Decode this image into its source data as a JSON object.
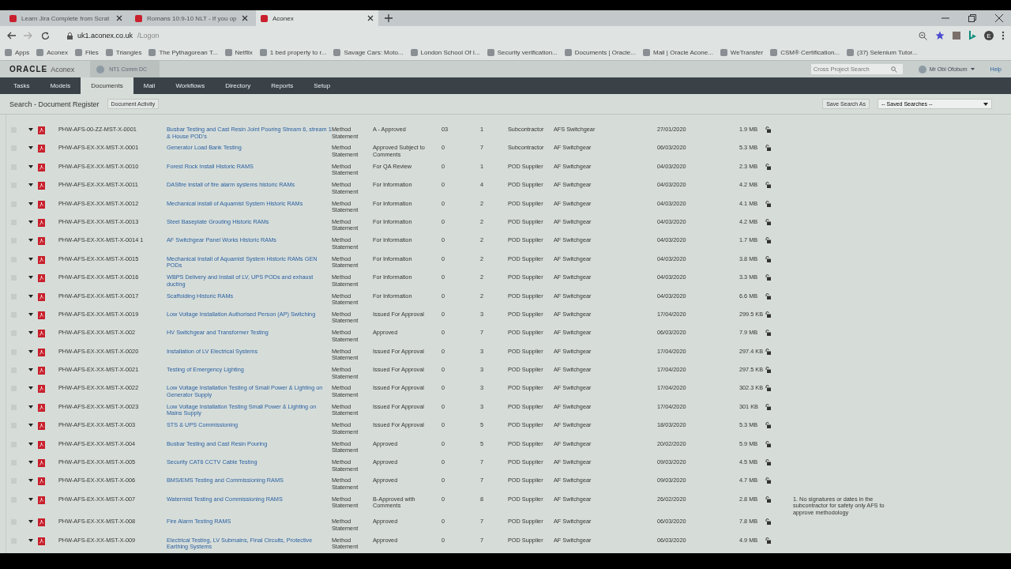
{
  "browser": {
    "tabs": [
      {
        "label": "Learn Jira Complete from Scrat",
        "selected": false
      },
      {
        "label": "Romans 10:9-10 NLT - If you op",
        "selected": false
      },
      {
        "label": "Aconex",
        "selected": true
      }
    ],
    "url_host": "uk1.aconex.co.uk",
    "url_path": "/Logon",
    "bookmarks": [
      "Apps",
      "Aconex",
      "Files",
      "Triangles",
      "The Pythagorean T...",
      "Netflix",
      "1 bed property to r...",
      "Savage Cars: Moto...",
      "London School Of I...",
      "Security verification...",
      "Documents | Oracle...",
      "Mail | Oracle Acone...",
      "WeTransfer",
      "CSM® Certification...",
      "(37) Selenium Tutor..."
    ],
    "profile": "E"
  },
  "app": {
    "brand": "ORACLE",
    "product": "Aconex",
    "project": "NT1 Comm DC",
    "search_placeholder": "Cross Project Search",
    "user": "Mr Obi Ofobum",
    "help": "Help"
  },
  "nav": [
    {
      "label": "Tasks",
      "selected": false
    },
    {
      "label": "Models",
      "selected": false
    },
    {
      "label": "Documents",
      "selected": true
    },
    {
      "label": "Mail",
      "selected": false
    },
    {
      "label": "Workflows",
      "selected": false
    },
    {
      "label": "Directory",
      "selected": false
    },
    {
      "label": "Reports",
      "selected": false
    },
    {
      "label": "Setup",
      "selected": false
    }
  ],
  "toolbar": {
    "title": "Search - Document Register",
    "activity": "Document Activity",
    "save_search": "Save Search As",
    "saved_searches": "-- Saved Searches --"
  },
  "rows": [
    {
      "checked": false,
      "number": "PHW-AFS-00-ZZ-MST-X-0001",
      "title": "Busbar Testing and Cast Resin Joint Pouring Stream 6, stream 1 & House POD's",
      "type": "Method Statement",
      "status": "A - Approved",
      "rev": "03",
      "version": "1",
      "discipline": "Subcontractor",
      "company": "AFS Switchgear",
      "date": "27/01/2020",
      "size": "1.9 MB"
    },
    {
      "checked": false,
      "number": "PHW-AFS-EX-XX-MST-X-0001",
      "title": "Generator Load Bank Testing",
      "type": "Method Statement",
      "status": "Approved Subject to Comments",
      "rev": "0",
      "version": "7",
      "discipline": "Subcontractor",
      "company": "AF Switchgear",
      "date": "06/03/2020",
      "size": "5.3 MB"
    },
    {
      "checked": false,
      "number": "PHW-AFS-EX-XX-MST-X-0010",
      "title": "Forest Rock Install Historic RAMS",
      "type": "Method Statement",
      "status": "For QA Review",
      "rev": "0",
      "version": "1",
      "discipline": "POD Supplier",
      "company": "AF Switchgear",
      "date": "04/03/2020",
      "size": "2.3 MB"
    },
    {
      "checked": false,
      "number": "PHW-AFS-EX-XX-MST-X-0011",
      "title": "DASfire install of fire alarm systems historic RAMs",
      "type": "Method Statement",
      "status": "For Information",
      "rev": "0",
      "version": "4",
      "discipline": "POD Supplier",
      "company": "AF Switchgear",
      "date": "04/03/2020",
      "size": "4.2 MB"
    },
    {
      "checked": false,
      "number": "PHW-AFS-EX-XX-MST-X-0012",
      "title": "Mechanical install of Aquamist System Historic RAMs",
      "type": "Method Statement",
      "status": "For Information",
      "rev": "0",
      "version": "2",
      "discipline": "POD Supplier",
      "company": "AF Switchgear",
      "date": "04/03/2020",
      "size": "4.1 MB"
    },
    {
      "checked": false,
      "number": "PHW-AFS-EX-XX-MST-X-0013",
      "title": "Steel Baseplate Grouting Historic RAMs",
      "type": "Method Statement",
      "status": "For Information",
      "rev": "0",
      "version": "2",
      "discipline": "POD Supplier",
      "company": "AF Switchgear",
      "date": "04/03/2020",
      "size": "4.2 MB"
    },
    {
      "checked": false,
      "number": "PHW-AFS-EX-XX-MST-X-0014 1",
      "title": "AF Switchgear Panel Works Historic RAMs",
      "type": "Method Statement",
      "status": "For Information",
      "rev": "0",
      "version": "2",
      "discipline": "POD Supplier",
      "company": "AF Switchgear",
      "date": "04/03/2020",
      "size": "1.7 MB"
    },
    {
      "checked": false,
      "number": "PHW-AFS-EX-XX-MST-X-0015",
      "title": "Mechanical Install of Aquamist System Historic RAMs GEN PODs",
      "type": "Method Statement",
      "status": "For Information",
      "rev": "0",
      "version": "2",
      "discipline": "POD Supplier",
      "company": "AF Switchgear",
      "date": "04/03/2020",
      "size": "3.8 MB"
    },
    {
      "checked": false,
      "number": "PHW-AFS-EX-XX-MST-X-0016",
      "title": "WBPS Delivery and Install of LV, UPS PODs and exhaust ducting",
      "type": "Method Statement",
      "status": "For Information",
      "rev": "0",
      "version": "2",
      "discipline": "POD Supplier",
      "company": "AF Switchgear",
      "date": "04/03/2020",
      "size": "3.3 MB"
    },
    {
      "checked": false,
      "number": "PHW-AFS-EX-XX-MST-X-0017",
      "title": "Scaffolding Historic RAMs",
      "type": "Method Statement",
      "status": "For Information",
      "rev": "0",
      "version": "2",
      "discipline": "POD Supplier",
      "company": "AF Switchgear",
      "date": "04/03/2020",
      "size": "6.6 MB"
    },
    {
      "checked": false,
      "number": "PHW-AFS-EX-XX-MST-X-0019",
      "title": "Low Voltage Installation Authorised Person (AP) Switching",
      "type": "Method Statement",
      "status": "Issued For Approval",
      "rev": "0",
      "version": "3",
      "discipline": "POD Supplier",
      "company": "AF Switchgear",
      "date": "17/04/2020",
      "size": "299.5 KB"
    },
    {
      "checked": false,
      "number": "PHW-AFS-EX-XX-MST-X-002",
      "title": "HV Switchgear and Transformer Testing",
      "type": "Method Statement",
      "status": "Approved",
      "rev": "0",
      "version": "7",
      "discipline": "POD Supplier",
      "company": "AF Switchgear",
      "date": "06/03/2020",
      "size": "7.9 MB"
    },
    {
      "checked": false,
      "number": "PHW-AFS-EX-XX-MST-X-0020",
      "title": "Installation of LV Electrical Systems",
      "type": "Method Statement",
      "status": "Issued For Approval",
      "rev": "0",
      "version": "3",
      "discipline": "POD Supplier",
      "company": "AF Switchgear",
      "date": "17/04/2020",
      "size": "297.4 KB"
    },
    {
      "checked": false,
      "number": "PHW-AFS-EX-XX-MST-X-0021",
      "title": "Testing of Emergency Lighting",
      "type": "Method Statement",
      "status": "Issued For Approval",
      "rev": "0",
      "version": "3",
      "discipline": "POD Supplier",
      "company": "AF Switchgear",
      "date": "17/04/2020",
      "size": "297.5 KB"
    },
    {
      "checked": false,
      "number": "PHW-AFS-EX-XX-MST-X-0022",
      "title": "Low Voltage Installation Testing of Small Power & Lighting on Generator Supply",
      "type": "Method Statement",
      "status": "Issued For Approval",
      "rev": "0",
      "version": "3",
      "discipline": "POD Supplier",
      "company": "AF Switchgear",
      "date": "17/04/2020",
      "size": "302.3 KB"
    },
    {
      "checked": false,
      "number": "PHW-AFS-EX-XX-MST-X-0023",
      "title": "Low Voltage Installation Testing Small Power & Lighting on Mains Supply",
      "type": "Method Statement",
      "status": "Issued For Approval",
      "rev": "0",
      "version": "3",
      "discipline": "POD Supplier",
      "company": "AF Switchgear",
      "date": "17/04/2020",
      "size": "301 KB"
    },
    {
      "checked": false,
      "number": "PHW-AFS-EX-XX-MST-X-003",
      "title": "STS & UPS Commissioning",
      "type": "Method Statement",
      "status": "Issued For Approval",
      "rev": "0",
      "version": "5",
      "discipline": "POD Supplier",
      "company": "AF Switchgear",
      "date": "18/03/2020",
      "size": "5.3 MB"
    },
    {
      "checked": false,
      "number": "PHW-AFS-EX-XX-MST-X-004",
      "title": "Busbar Testing and Cast Resin Pouring",
      "type": "Method Statement",
      "status": "Approved",
      "rev": "0",
      "version": "5",
      "discipline": "POD Supplier",
      "company": "AF Switchgear",
      "date": "20/02/2020",
      "size": "5.9 MB"
    },
    {
      "checked": false,
      "number": "PHW-AFS-EX-XX-MST-X-005",
      "title": "Security CAT6 CCTV Cable Testing",
      "type": "Method Statement",
      "status": "Approved",
      "rev": "0",
      "version": "7",
      "discipline": "POD Supplier",
      "company": "AF Switchgear",
      "date": "09/03/2020",
      "size": "4.5 MB"
    },
    {
      "checked": false,
      "number": "PHW-AFS-EX-XX-MST-X-006",
      "title": "BMS/EMS Testing and Commissioning RAMS",
      "type": "Method Statement",
      "status": "Approved",
      "rev": "0",
      "version": "7",
      "discipline": "POD Supplier",
      "company": "AF Switchgear",
      "date": "09/03/2020",
      "size": "4.7 MB"
    },
    {
      "checked": false,
      "number": "PHW-AFS-EX-XX-MST-X-007",
      "title": "Watermist Testing and Commissioning RAMS",
      "type": "Method Statement",
      "status": "B-Approved with Comments",
      "rev": "0",
      "version": "8",
      "discipline": "POD Supplier",
      "company": "AF Switchgear",
      "date": "26/02/2020",
      "size": "2.8 MB",
      "note": "1. No signatures or dates in the subcontractor for safety only AFS to approve methodology"
    },
    {
      "checked": false,
      "number": "PHW-AFS-EX-XX-MST-X-008",
      "title": "Fire Alarm Testing RAMS",
      "type": "Method Statement",
      "status": "Approved",
      "rev": "0",
      "version": "7",
      "discipline": "POD Supplier",
      "company": "AF Switchgear",
      "date": "06/03/2020",
      "size": "7.8 MB"
    },
    {
      "checked": false,
      "number": "PHW-AFS-EX-XX-MST-X-009",
      "title": "Electrical Testing, LV Submains, Final Circuits, Protective Earthing Systems",
      "type": "Method Statement",
      "status": "Approved",
      "rev": "0",
      "version": "7",
      "discipline": "POD Supplier",
      "company": "AF Switchgear",
      "date": "06/03/2020",
      "size": "4.9 MB"
    }
  ]
}
